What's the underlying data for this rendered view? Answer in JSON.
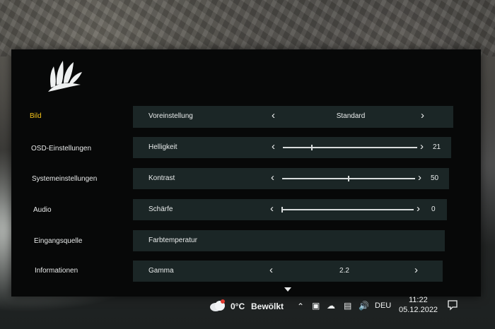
{
  "menu": {
    "items": [
      {
        "label": "Bild",
        "active": true
      },
      {
        "label": "OSD-Einstellungen",
        "active": false
      },
      {
        "label": "Systemeinstellungen",
        "active": false
      },
      {
        "label": "Audio",
        "active": false
      },
      {
        "label": "Eingangsquelle",
        "active": false
      },
      {
        "label": "Informationen",
        "active": false
      }
    ]
  },
  "settings": {
    "preset": {
      "label": "Voreinstellung",
      "value": "Standard"
    },
    "brightness": {
      "label": "Helligkeit",
      "value": "21",
      "level": 0.21
    },
    "contrast": {
      "label": "Kontrast",
      "value": "50",
      "level": 0.5
    },
    "sharpness": {
      "label": "Schärfe",
      "value": "0",
      "level": 0.0
    },
    "color_temp": {
      "label": "Farbtemperatur"
    },
    "gamma": {
      "label": "Gamma",
      "value": "2.2"
    }
  },
  "taskbar": {
    "weather_temp": "0°C",
    "weather_text": "Bewölkt",
    "language": "DEU",
    "time": "11:22",
    "date": "05.12.2022"
  },
  "colors": {
    "accent": "#f3c21a",
    "row_bg": "#1b2626",
    "panel_bg": "#070808"
  },
  "icons": {
    "logo": "corsair-sails-logo",
    "weather": "cloud-icon",
    "prev": "chevron-left-icon",
    "next": "chevron-right-icon"
  }
}
